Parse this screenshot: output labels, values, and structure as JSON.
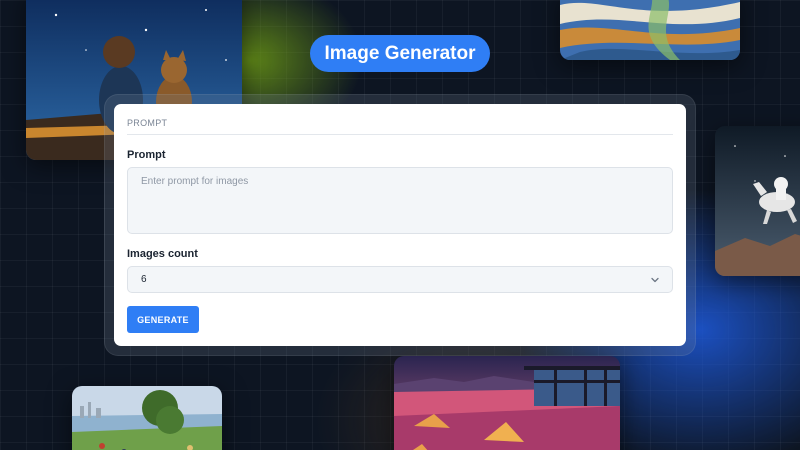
{
  "app": {
    "title": "Image Generator"
  },
  "form": {
    "section_label": "PROMPT",
    "prompt_label": "Prompt",
    "prompt_placeholder": "Enter prompt for images",
    "prompt_value": "",
    "count_label": "Images count",
    "count_value": "6",
    "generate_label": "GENERATE"
  },
  "colors": {
    "accent": "#2f7ef5",
    "background": "#0d1522",
    "card": "#ffffff",
    "input_background": "#f3f6f9"
  },
  "icons": {
    "select_chevron": "chevron-down-icon"
  },
  "gallery": [
    {
      "subject": "boy-and-cat-night-sky"
    },
    {
      "subject": "abstract-painting"
    },
    {
      "subject": "astronaut-riding-horse"
    },
    {
      "subject": "park-lakeside-painting"
    },
    {
      "subject": "low-poly-desert-sunset"
    }
  ]
}
